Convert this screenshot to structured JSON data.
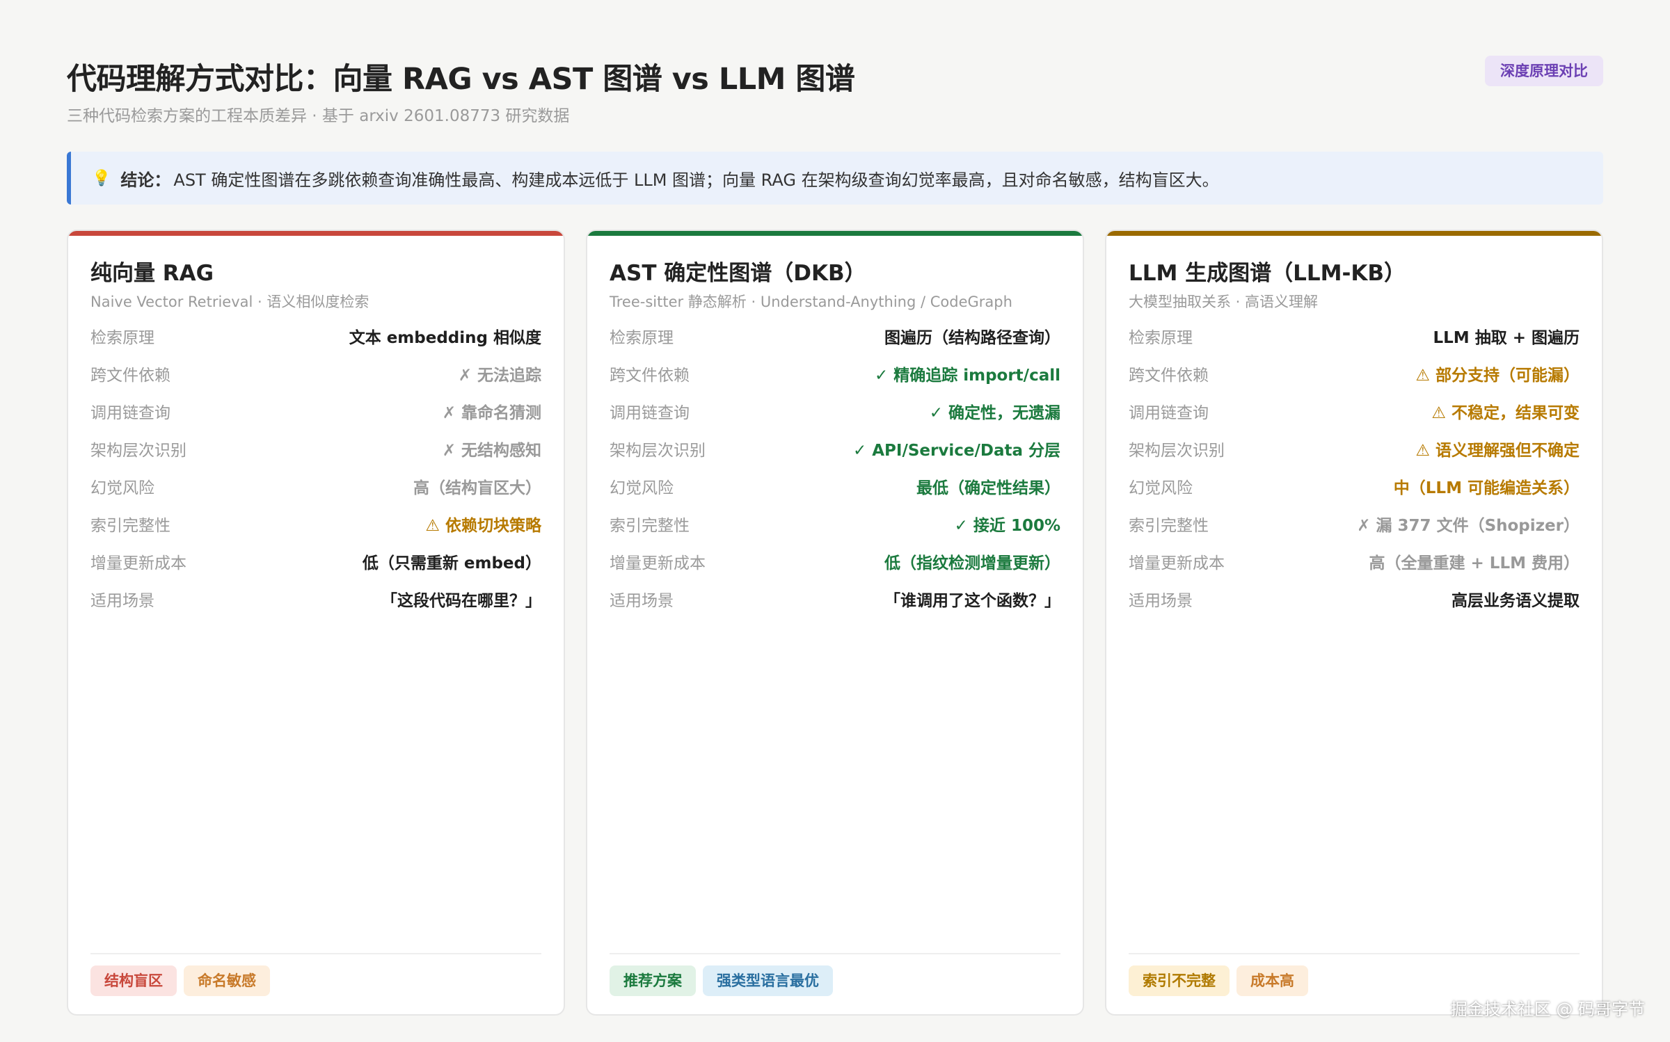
{
  "header": {
    "title": "代码理解方式对比：向量 RAG vs AST 图谱 vs LLM 图谱",
    "subtitle": "三种代码检索方案的工程本质差异 · 基于 arxiv 2601.08773 研究数据",
    "badge": "深度原理对比"
  },
  "conclusion": {
    "icon": "lightbulb-icon",
    "label": "结论：",
    "text": "AST 确定性图谱在多跳依赖查询准确性最高、构建成本远低于 LLM 图谱；向量 RAG 在架构级查询幻觉率最高，且对命名敏感，结构盲区大。"
  },
  "colors": {
    "rag_accent": "#c8473b",
    "dkb_accent": "#1b7a3e",
    "llm_accent": "#9a6a00",
    "conclusion_accent": "#3a78d4"
  },
  "cards": [
    {
      "title": "纯向量 RAG",
      "subtitle": "Naive Vector Retrieval · 语义相似度检索",
      "rows": [
        {
          "k": "检索原理",
          "v": "文本 embedding 相似度",
          "tone": "dark"
        },
        {
          "k": "跨文件依赖",
          "v": "✗ 无法追踪",
          "tone": "gray"
        },
        {
          "k": "调用链查询",
          "v": "✗ 靠命名猜测",
          "tone": "gray"
        },
        {
          "k": "架构层次识别",
          "v": "✗ 无结构感知",
          "tone": "gray"
        },
        {
          "k": "幻觉风险",
          "v": "高（结构盲区大）",
          "tone": "gray"
        },
        {
          "k": "索引完整性",
          "v": "⚠ 依赖切块策略",
          "tone": "amber"
        },
        {
          "k": "增量更新成本",
          "v": "低（只需重新 embed）",
          "tone": "dark"
        },
        {
          "k": "适用场景",
          "v": "「这段代码在哪里？」",
          "tone": "dark"
        }
      ],
      "tags": [
        {
          "label": "结构盲区",
          "tone": "red"
        },
        {
          "label": "命名敏感",
          "tone": "orange"
        }
      ]
    },
    {
      "title": "AST 确定性图谱（DKB）",
      "subtitle": "Tree-sitter 静态解析 · Understand-Anything / CodeGraph",
      "rows": [
        {
          "k": "检索原理",
          "v": "图遍历（结构路径查询）",
          "tone": "dark"
        },
        {
          "k": "跨文件依赖",
          "v": "✓ 精确追踪 import/call",
          "tone": "green"
        },
        {
          "k": "调用链查询",
          "v": "✓ 确定性，无遗漏",
          "tone": "green"
        },
        {
          "k": "架构层次识别",
          "v": "✓ API/Service/Data 分层",
          "tone": "green"
        },
        {
          "k": "幻觉风险",
          "v": "最低（确定性结果）",
          "tone": "green"
        },
        {
          "k": "索引完整性",
          "v": "✓ 接近 100%",
          "tone": "green"
        },
        {
          "k": "增量更新成本",
          "v": "低（指纹检测增量更新）",
          "tone": "green"
        },
        {
          "k": "适用场景",
          "v": "「谁调用了这个函数？」",
          "tone": "dark"
        }
      ],
      "tags": [
        {
          "label": "推荐方案",
          "tone": "green"
        },
        {
          "label": "强类型语言最优",
          "tone": "blue"
        }
      ]
    },
    {
      "title": "LLM 生成图谱（LLM-KB）",
      "subtitle": "大模型抽取关系 · 高语义理解",
      "rows": [
        {
          "k": "检索原理",
          "v": "LLM 抽取 + 图遍历",
          "tone": "dark"
        },
        {
          "k": "跨文件依赖",
          "v": "⚠ 部分支持（可能漏）",
          "tone": "amber"
        },
        {
          "k": "调用链查询",
          "v": "⚠ 不稳定，结果可变",
          "tone": "amber"
        },
        {
          "k": "架构层次识别",
          "v": "⚠ 语义理解强但不确定",
          "tone": "amber"
        },
        {
          "k": "幻觉风险",
          "v": "中（LLM 可能编造关系）",
          "tone": "amber"
        },
        {
          "k": "索引完整性",
          "v": "✗ 漏 377 文件（Shopizer）",
          "tone": "gray"
        },
        {
          "k": "增量更新成本",
          "v": "高（全量重建 + LLM 费用）",
          "tone": "gray"
        },
        {
          "k": "适用场景",
          "v": "高层业务语义提取",
          "tone": "dark"
        }
      ],
      "tags": [
        {
          "label": "索引不完整",
          "tone": "yellow"
        },
        {
          "label": "成本高",
          "tone": "orange"
        }
      ]
    }
  ],
  "watermark": "掘金技术社区 @ 码哥字节"
}
